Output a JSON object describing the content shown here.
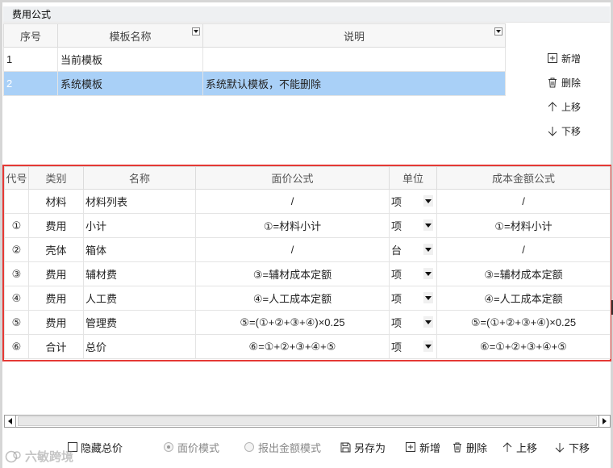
{
  "section": {
    "title": "费用公式"
  },
  "templates": {
    "headers": [
      "序号",
      "模板名称",
      "说明"
    ],
    "rows": [
      {
        "no": "1",
        "name": "当前模板",
        "desc": ""
      },
      {
        "no": "2",
        "name": "系统模板",
        "desc": "系统默认模板，不能删除",
        "selected": true
      }
    ]
  },
  "side_actions": {
    "add": "新增",
    "delete": "删除",
    "up": "上移",
    "down": "下移"
  },
  "formula_table": {
    "headers": [
      "代号",
      "类别",
      "名称",
      "面价公式",
      "单位",
      "成本金额公式"
    ],
    "rows": [
      {
        "code": "",
        "category": "材料",
        "name": "材料列表",
        "price_formula": "/",
        "unit": "项",
        "cost_formula": "/"
      },
      {
        "code": "①",
        "category": "费用",
        "name": "小计",
        "price_formula": "①=材料小计",
        "unit": "项",
        "cost_formula": "①=材料小计"
      },
      {
        "code": "②",
        "category": "壳体",
        "name": "箱体",
        "price_formula": "/",
        "unit": "台",
        "cost_formula": "/"
      },
      {
        "code": "③",
        "category": "费用",
        "name": "辅材费",
        "price_formula": "③=辅材成本定额",
        "unit": "项",
        "cost_formula": "③=辅材成本定额"
      },
      {
        "code": "④",
        "category": "费用",
        "name": "人工费",
        "price_formula": "④=人工成本定额",
        "unit": "项",
        "cost_formula": "④=人工成本定额"
      },
      {
        "code": "⑤",
        "category": "费用",
        "name": "管理费",
        "price_formula": "⑤=(①+②+③+④)×0.25",
        "unit": "项",
        "cost_formula": "⑤=(①+②+③+④)×0.25"
      },
      {
        "code": "⑥",
        "category": "合计",
        "name": "总价",
        "price_formula": "⑥=①+②+③+④+⑤",
        "unit": "项",
        "cost_formula": "⑥=①+②+③+④+⑤"
      }
    ]
  },
  "bottom_bar": {
    "hide_cost": "隐藏总价",
    "price_mode": "面价模式",
    "quote_mode": "报出金额模式",
    "save_as": "另存为",
    "add": "新增",
    "delete": "删除",
    "up": "上移",
    "down": "下移"
  },
  "watermark": "六敏跨境",
  "colors": {
    "selection": "#a9d0f7",
    "highlight_border": "#e53935"
  }
}
